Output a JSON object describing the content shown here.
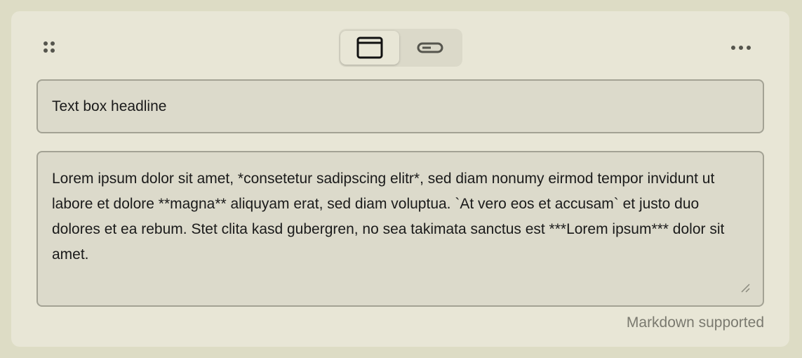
{
  "toolbar": {
    "drag_handle_icon": "drag-handle-icon",
    "view_toggle": {
      "options": [
        {
          "icon": "window-view-icon",
          "selected": true
        },
        {
          "icon": "compact-bar-icon",
          "selected": false
        }
      ]
    },
    "more_icon": "more-horizontal-icon"
  },
  "headline": {
    "value": "Text box headline"
  },
  "body": {
    "value": "Lorem ipsum dolor sit amet, *consetetur sadipscing elitr*, sed diam nonumy eirmod tempor invidunt ut labore et dolore **magna** aliquyam erat, sed diam voluptua. `At vero eos et accusam` et justo duo dolores et ea rebum. Stet clita kasd gubergren, no sea takimata sanctus est ***Lorem ipsum*** dolor sit amet."
  },
  "hint": {
    "text": "Markdown supported"
  },
  "colors": {
    "background": "#dddcc5",
    "card": "#e8e6d6",
    "field": "#dcdacb",
    "field_border": "#a3a294",
    "hint_text": "#7a796f"
  }
}
